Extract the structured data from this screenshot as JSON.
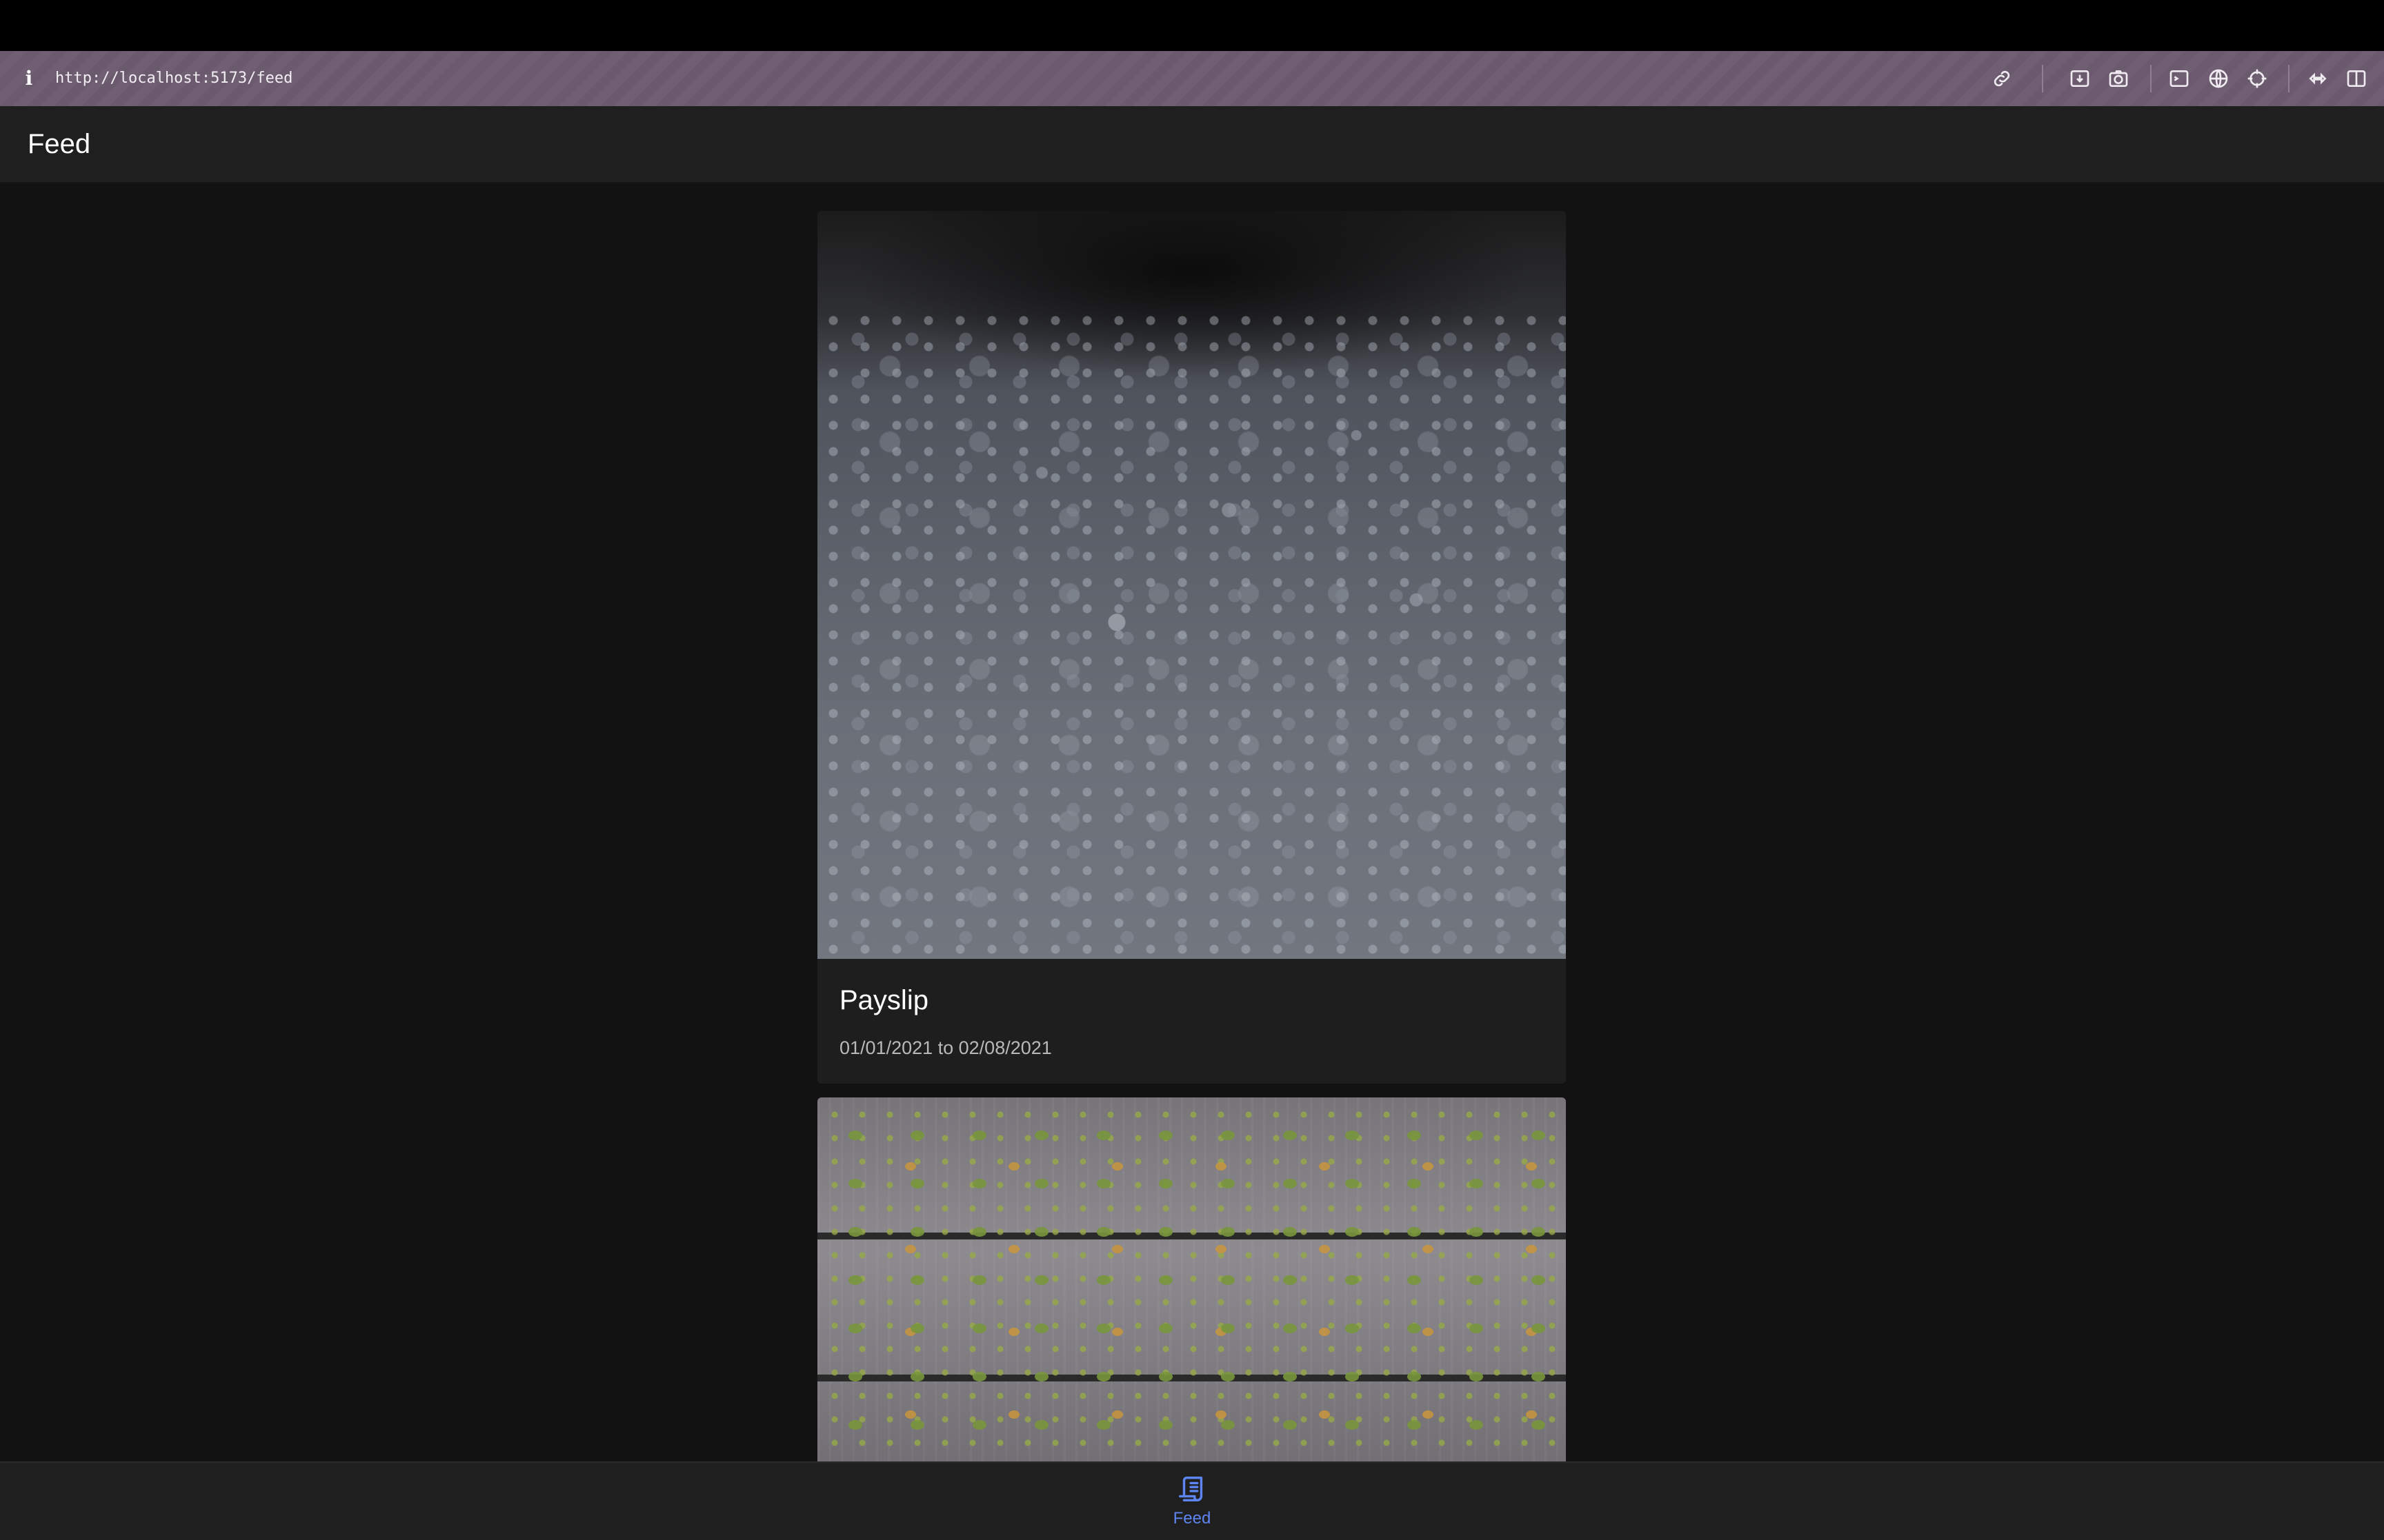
{
  "browser": {
    "url": "http://localhost:5173/feed",
    "icons": [
      "info-icon",
      "link-icon",
      "download-icon",
      "camera-icon",
      "terminal-icon",
      "globe-icon",
      "crosshair-icon",
      "extension-icon",
      "sidebar-icon"
    ]
  },
  "header": {
    "title": "Feed"
  },
  "feed": {
    "items": [
      {
        "title": "Payslip",
        "date_range": "01/01/2021 to 02/08/2021",
        "image": "water-droplets-photo"
      },
      {
        "title": "",
        "date_range": "",
        "image": "wooden-deck-leaves-photo"
      }
    ]
  },
  "bottom_nav": {
    "items": [
      {
        "label": "Feed",
        "icon": "feed-icon",
        "active": true
      }
    ],
    "active_color": "#5d84f0"
  },
  "colors": {
    "browser_bar": "#6b5a6e",
    "background": "#121212",
    "surface": "#1e1e1e"
  }
}
